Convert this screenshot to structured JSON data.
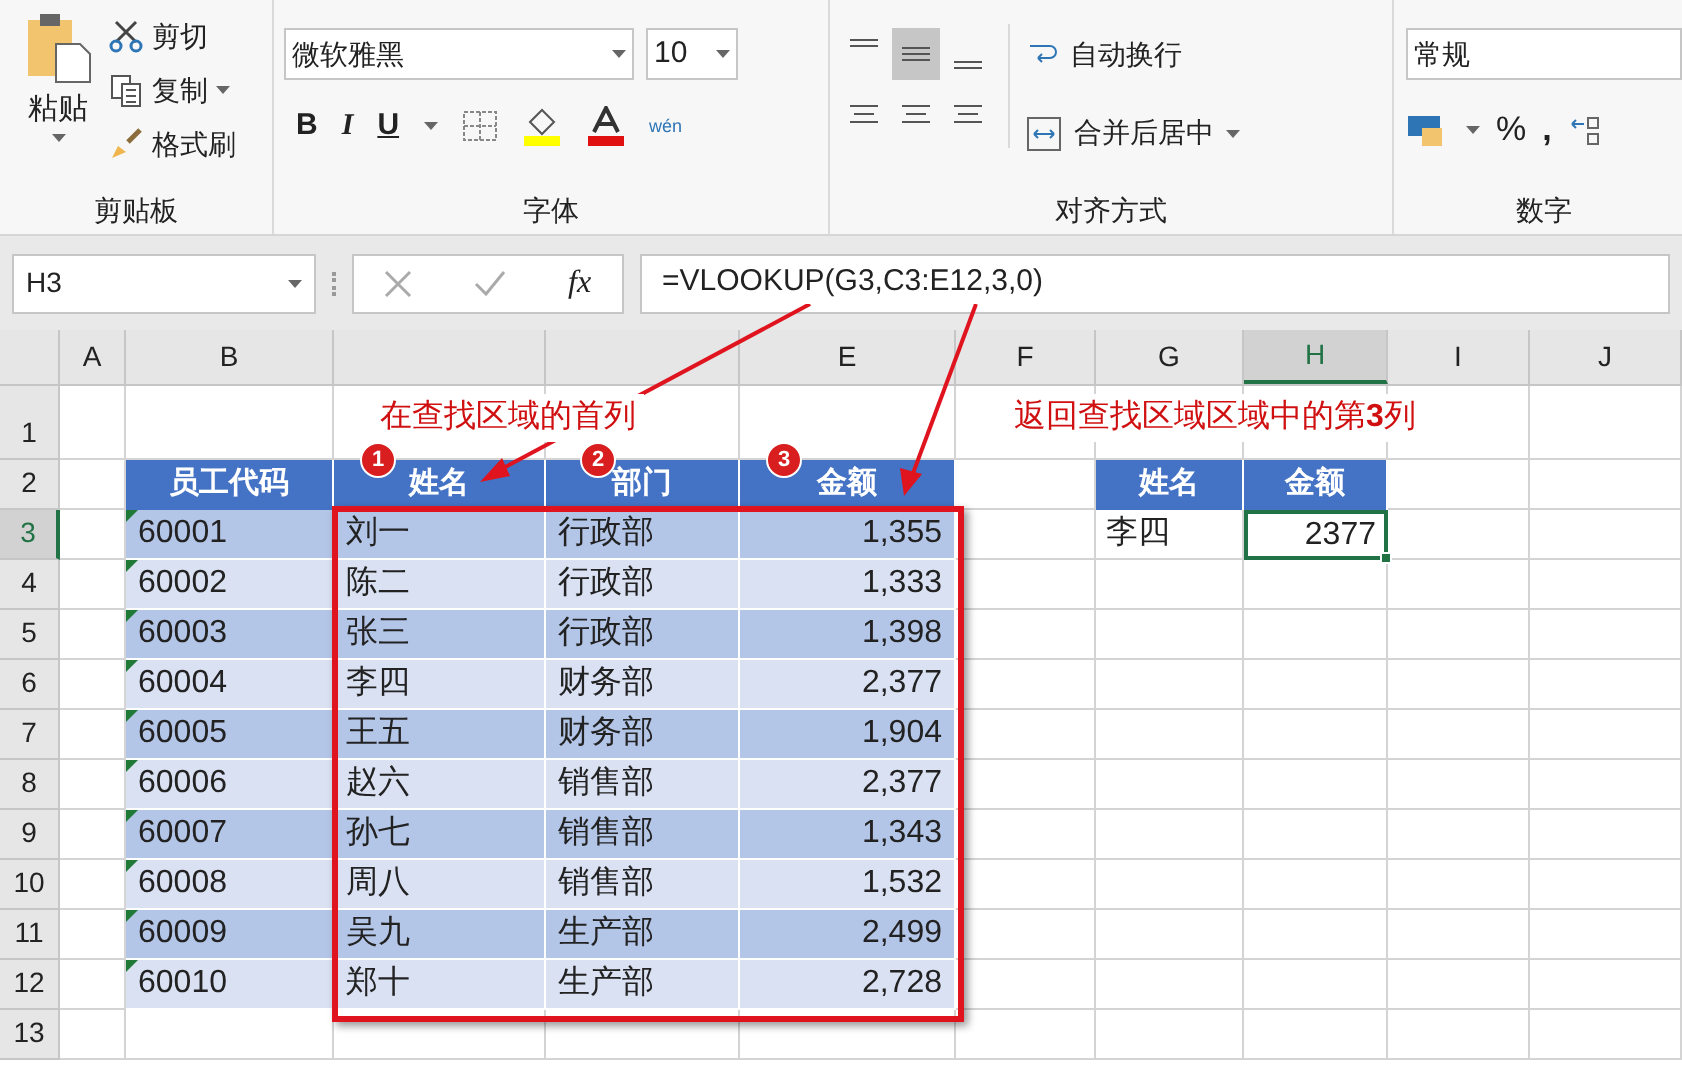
{
  "ribbon": {
    "clipboard": {
      "paste": "粘贴",
      "items": [
        {
          "label": "剪切",
          "kind": "cut"
        },
        {
          "label": "复制",
          "kind": "copy"
        },
        {
          "label": "格式刷",
          "kind": "brush"
        }
      ],
      "title": "剪贴板"
    },
    "font": {
      "font_name": "微软雅黑",
      "font_size": "10",
      "bold": "B",
      "italic": "I",
      "underline": "U",
      "phonetic": "wén",
      "title": "字体"
    },
    "alignment": {
      "vertical": [
        {
          "selected": false
        },
        {
          "selected": true
        },
        {
          "selected": false
        }
      ],
      "wrap": "自动换行",
      "merge": "合并后居中",
      "title": "对齐方式"
    },
    "number": {
      "format": "常规",
      "percent": "%",
      "comma": ",",
      "title": "数字"
    }
  },
  "formula_bar": {
    "cell_ref": "H3",
    "fx": "fx",
    "formula": "=VLOOKUP(G3,C3:E12,3,0)"
  },
  "columns": [
    {
      "label": "A",
      "selected": false
    },
    {
      "label": "B",
      "selected": false
    },
    {
      "selected": false
    },
    {
      "selected": false
    },
    {
      "label": "E",
      "selected": false
    },
    {
      "label": "F",
      "selected": false
    },
    {
      "label": "G",
      "selected": false
    },
    {
      "label": "H",
      "selected": true
    },
    {
      "label": "I",
      "selected": false
    },
    {
      "label": "J",
      "selected": false
    }
  ],
  "rows": [
    {
      "label": "1",
      "selected": false
    },
    {
      "label": "2",
      "selected": false
    },
    {
      "label": "3",
      "selected": true
    },
    {
      "label": "4",
      "selected": false
    },
    {
      "label": "5",
      "selected": false
    },
    {
      "label": "6",
      "selected": false
    },
    {
      "label": "7",
      "selected": false
    },
    {
      "label": "8",
      "selected": false
    },
    {
      "label": "9",
      "selected": false
    },
    {
      "label": "10",
      "selected": false
    },
    {
      "label": "11",
      "selected": false
    },
    {
      "label": "12",
      "selected": false
    },
    {
      "label": "13",
      "selected": false
    }
  ],
  "table": {
    "headers": [
      "员工代码",
      "姓名",
      "部门",
      "金额"
    ],
    "rows": [
      [
        "60001",
        "刘一",
        "行政部",
        "1,355"
      ],
      [
        "60002",
        "陈二",
        "行政部",
        "1,333"
      ],
      [
        "60003",
        "张三",
        "行政部",
        "1,398"
      ],
      [
        "60004",
        "李四",
        "财务部",
        "2,377"
      ],
      [
        "60005",
        "王五",
        "财务部",
        "1,904"
      ],
      [
        "60006",
        "赵六",
        "销售部",
        "2,377"
      ],
      [
        "60007",
        "孙七",
        "销售部",
        "1,343"
      ],
      [
        "60008",
        "周八",
        "销售部",
        "1,532"
      ],
      [
        "60009",
        "吴九",
        "生产部",
        "2,499"
      ],
      [
        "60010",
        "郑十",
        "生产部",
        "2,728"
      ]
    ]
  },
  "lookup": {
    "headers": [
      "姓名",
      "金额"
    ],
    "name": "李四",
    "amount": "2377"
  },
  "annotations": {
    "first_column": "在查找区域的首列",
    "return_column": "返回查找区域区域中的第**3**列",
    "markers": [
      "1",
      "2",
      "3"
    ]
  }
}
